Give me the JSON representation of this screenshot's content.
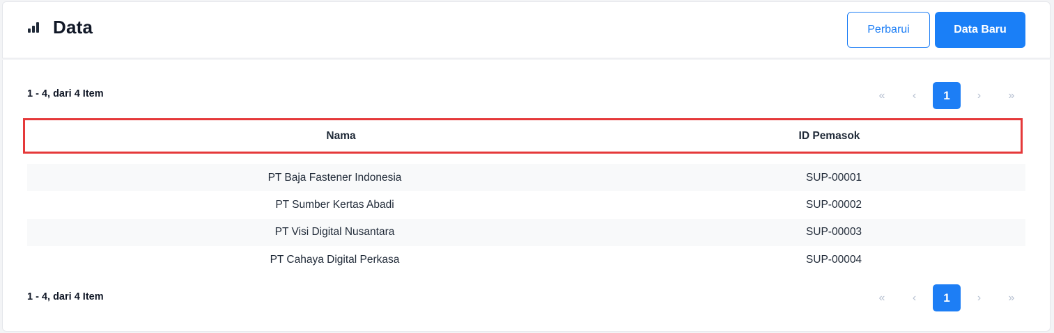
{
  "header": {
    "title": "Data",
    "icon": "bar-chart-icon",
    "buttons": {
      "refresh": "Perbarui",
      "new": "Data Baru"
    }
  },
  "summary": {
    "top": "1 - 4, dari 4 Item",
    "bottom": "1 - 4, dari 4 Item"
  },
  "pagination": {
    "first": "«",
    "prev": "‹",
    "current": "1",
    "next": "›",
    "last": "»"
  },
  "table": {
    "columns": [
      "Nama",
      "ID Pemasok"
    ],
    "rows": [
      [
        "PT Baja Fastener Indonesia",
        "SUP-00001"
      ],
      [
        "PT Sumber Kertas Abadi",
        "SUP-00002"
      ],
      [
        "PT Visi Digital Nusantara",
        "SUP-00003"
      ],
      [
        "PT Cahaya Digital Perkasa",
        "SUP-00004"
      ]
    ]
  },
  "colors": {
    "accent": "#1a7ff7",
    "highlight": "#e5393a",
    "stripe": "#f8f9fa"
  }
}
